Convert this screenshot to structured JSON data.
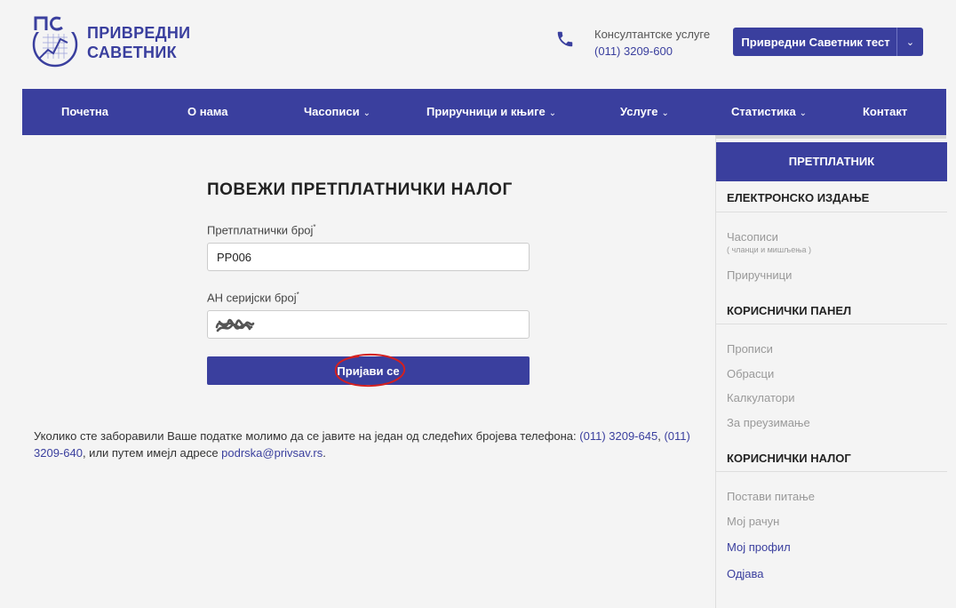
{
  "header": {
    "brand_line1": "ПРИВРЕДНИ",
    "brand_line2": "САВЕТНИК",
    "consult_label": "Консултантске услуге",
    "consult_phone": "(011) 3209-600",
    "user_button": "Привредни Саветник тест",
    "user_caret": "⌄"
  },
  "nav": {
    "caret": "⌄",
    "items": [
      {
        "label": "Почетна"
      },
      {
        "label": "О нама"
      },
      {
        "label": "Часописи"
      },
      {
        "label": "Приручници и књиге"
      },
      {
        "label": "Услуге"
      },
      {
        "label": "Статистика"
      },
      {
        "label": "Контакт"
      }
    ]
  },
  "form": {
    "title": "ПОВЕЖИ ПРЕТПЛАТНИЧКИ НАЛОГ",
    "field1_label": "Претплатнички број",
    "field1_value": "PP006",
    "field2_label": "АН серијски број",
    "required_mark": "*",
    "submit": "Пријави се"
  },
  "info": {
    "text_before": "Уколико сте заборавили Ваше податке молимо да се јавите на један од следећих бројева телефона: ",
    "phone1": "(011) 3209-645",
    "sep": ", ",
    "phone2": "(011) 3209-640",
    "text_mid": ", или путем имејл адресе ",
    "email": "podrska@privsav.rs",
    "text_end": "."
  },
  "sidebar": {
    "header": "ПРЕТПЛАТНИК",
    "section1": "ЕЛЕКТРОНСКО ИЗДАЊЕ",
    "s1_item1": "Часописи",
    "s1_item1_sub": "( чланци и мишљења )",
    "s1_item2": "Приручници",
    "section2": "КОРИСНИЧКИ ПАНЕЛ",
    "s2_item1": "Прописи",
    "s2_item2": "Обрасци",
    "s2_item3": "Калкулатори",
    "s2_item4": "За преузимање",
    "section3": "КОРИСНИЧКИ НАЛОГ",
    "s3_item1": "Постави питање",
    "s3_item2": "Мој рачун",
    "s3_item3": "Мој профил",
    "s3_item4": "Одјава"
  },
  "colors": {
    "primary": "#3a3f9e",
    "annotation": "#d42020"
  }
}
